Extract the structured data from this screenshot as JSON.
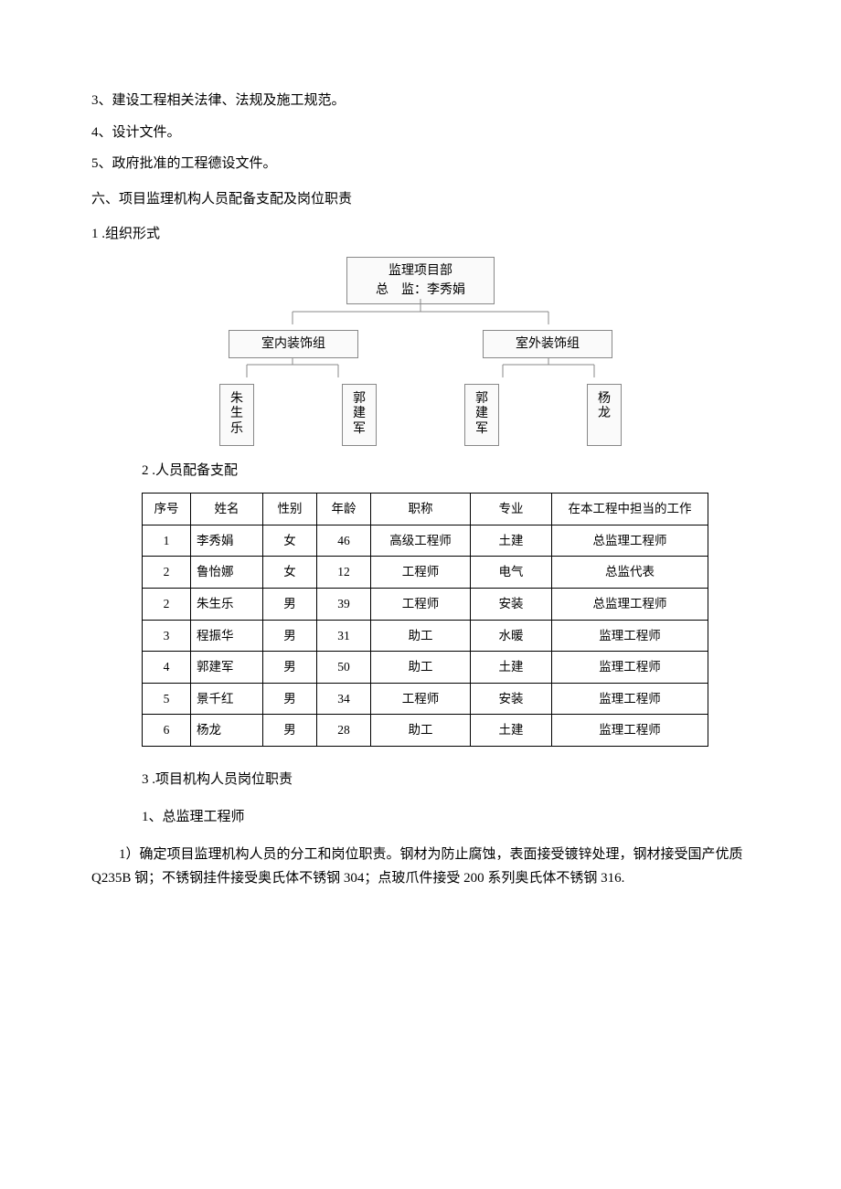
{
  "lines": {
    "l3": "3、建设工程相关法律、法规及施工规范。",
    "l4": "4、设计文件。",
    "l5": "5、政府批准的工程德设文件。",
    "sec6": "六、项目监理机构人员配备支配及岗位职责",
    "sub1": "1 .组织形式",
    "sub2": "2 .人员配备支配",
    "sub3": "3 .项目机构人员岗位职责",
    "role1": "1、总监理工程师",
    "p1": "1）确定项目监理机构人员的分工和岗位职责。钢材为防止腐蚀，表面接受镀锌处理，钢材接受国产优质 Q235B 钢；不锈钢挂件接受奥氏体不锈钢 304；点玻爪件接受 200 系列奥氏体不锈钢 316."
  },
  "org": {
    "top_line1": "监理项目部",
    "top_line2": "总　监：李秀娟",
    "row2_left": "室内装饰组",
    "row2_right": "室外装饰组",
    "leaf1": "朱生乐",
    "leaf2": "郭建军",
    "leaf3": "郭建军",
    "leaf4": "杨龙"
  },
  "table": {
    "headers": [
      "序号",
      "姓名",
      "性别",
      "年龄",
      "职称",
      "专业",
      "在本工程中担当的工作"
    ],
    "rows": [
      [
        "1",
        "李秀娟",
        "女",
        "46",
        "高级工程师",
        "土建",
        "总监理工程师"
      ],
      [
        "2",
        "鲁怡娜",
        "女",
        "12",
        "工程师",
        "电气",
        "总监代表"
      ],
      [
        "2",
        "朱生乐",
        "男",
        "39",
        "工程师",
        "安装",
        "总监理工程师"
      ],
      [
        "3",
        "程振华",
        "男",
        "31",
        "助工",
        "水暖",
        "监理工程师"
      ],
      [
        "4",
        "郭建军",
        "男",
        "50",
        "助工",
        "土建",
        "监理工程师"
      ],
      [
        "5",
        "景千红",
        "男",
        "34",
        "工程师",
        "安装",
        "监理工程师"
      ],
      [
        "6",
        "杨龙",
        "男",
        "28",
        "助工",
        "土建",
        "监理工程师"
      ]
    ]
  }
}
